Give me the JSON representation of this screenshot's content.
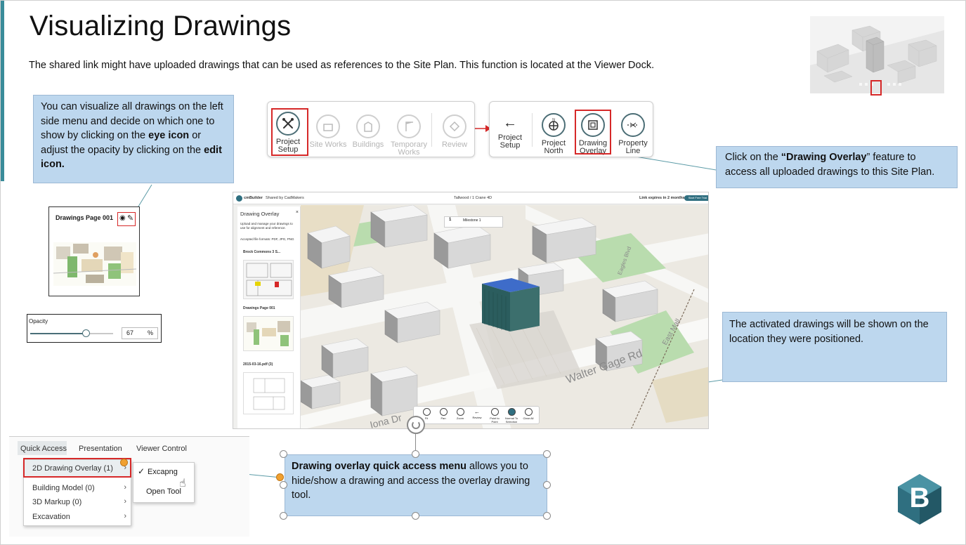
{
  "slide": {
    "title": "Visualizing Drawings",
    "subtitle": "The shared link might have uploaded drawings that can be used as references to the Site Plan. This function is located at the Viewer Dock.",
    "accent_color": "#3a8c9a"
  },
  "callouts": {
    "left": {
      "p1": "You can visualize all drawings on the left side menu and decide on which one to show by clicking on the ",
      "b1": "eye icon",
      "p2": " or adjust the opacity by clicking on the ",
      "b2": "edit icon."
    },
    "right_top": {
      "p1": "Click on the ",
      "b1": "“Drawing Overlay",
      "p2": "” feature to access all uploaded drawings to this Site Plan."
    },
    "right_mid": {
      "text": "The activated drawings will be shown on the location they were positioned."
    },
    "bottom": {
      "b1": "Drawing overlay quick access menu",
      "p1": " allows you to hide/show a drawing and access the overlay drawing tool."
    },
    "fill_color": "#bdd7ee"
  },
  "dock_left": {
    "items": [
      {
        "label": "Project Setup",
        "icon": "tools-icon",
        "active": true
      },
      {
        "label": "Site Works",
        "icon": "site-works-icon",
        "active": false
      },
      {
        "label": "Buildings",
        "icon": "buildings-icon",
        "active": false
      },
      {
        "label": "Temporary Works",
        "icon": "crane-icon",
        "active": false
      },
      {
        "label": "Review",
        "icon": "review-icon",
        "active": false
      }
    ]
  },
  "dock_right": {
    "back_label": "Project Setup",
    "items": [
      {
        "label": "Project North",
        "icon": "compass-icon"
      },
      {
        "label": "Drawing Overlay",
        "icon": "drawing-overlay-icon"
      },
      {
        "label": "Property Line",
        "icon": "property-line-icon"
      }
    ]
  },
  "drawings_card": {
    "title": "Drawings Page 001"
  },
  "opacity": {
    "label": "Opacity",
    "value": "67",
    "unit": "%",
    "level_percent": 67
  },
  "viewer": {
    "brand": "cmBuilder",
    "shared_by": "Shared by CadMakers",
    "project": "Tallwood / 1 Crane 4D",
    "link_expires": "Link expires in 2 months",
    "trial_button": "Start Free Trial",
    "panel_title": "Drawing Overlay",
    "panel_desc": "Upload and manage your drawings to use for alignment and reference.",
    "panel_formats": "Accepted file formats: PDF, JPG, PNG",
    "drawings": [
      {
        "name": "Brock Commons 3 S..."
      },
      {
        "name": "Drawings Page 001"
      },
      {
        "name": "2015-03-16.pdf (3)"
      }
    ],
    "timeline_day": "1",
    "timeline_label": "Milestone 1",
    "street_labels": [
      "Walter Gage Rd",
      "Iona Dr",
      "East Mall",
      "Eagles Blvd"
    ],
    "bottom_tools": [
      "Fit",
      "Pan",
      "Zoom",
      "Review",
      "Point to Point",
      "Normal To Selection",
      "Clear All"
    ]
  },
  "quick_access": {
    "tabs": [
      "Quick Access",
      "Presentation",
      "Viewer Control"
    ],
    "menu": [
      {
        "label": "2D Drawing Overlay (1)"
      },
      {
        "label": "Building Model (0)"
      },
      {
        "label": "3D Markup (0)"
      },
      {
        "label": "Excavation"
      }
    ],
    "submenu": [
      {
        "label": "Excapng",
        "checked": true
      },
      {
        "label": "Open Tool",
        "checked": false
      }
    ]
  },
  "logo": {
    "letter": "B",
    "color": "#2f6f80"
  }
}
